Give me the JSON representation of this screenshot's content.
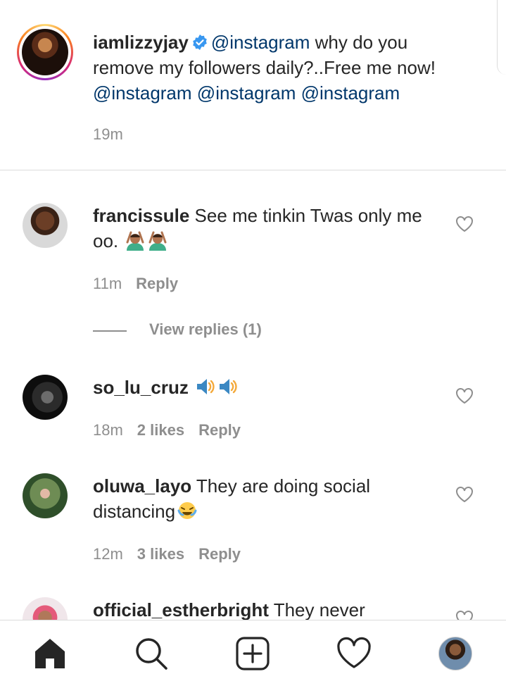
{
  "caption": {
    "username": "iamlizzyjay",
    "text_parts": [
      "@instagram",
      " why do you remove my followers daily?..Free me now! ",
      "@instagram",
      " ",
      "@instagram",
      " ",
      "@instagram"
    ],
    "time": "19m"
  },
  "comments": [
    {
      "username": "francissule",
      "text": "See me tinkin Twas only me oo.",
      "emojis": [
        "person-gesturing-ok",
        "person-gesturing-ok"
      ],
      "time": "11m",
      "likes": "",
      "reply_label": "Reply",
      "view_replies": "View replies (1)"
    },
    {
      "username": "so_lu_cruz",
      "text": "",
      "emojis": [
        "speaker-high-volume",
        "speaker-high-volume"
      ],
      "time": "18m",
      "likes": "2 likes",
      "reply_label": "Reply"
    },
    {
      "username": "oluwa_layo",
      "text": "They are doing social distancing",
      "emojis": [
        "face-with-tears-of-joy"
      ],
      "time": "12m",
      "likes": "3 likes",
      "reply_label": "Reply"
    },
    {
      "username": "official_estherbright",
      "text": "They never"
    }
  ],
  "nav": {
    "items": [
      "home-icon",
      "search-icon",
      "new-post-icon",
      "activity-heart-icon",
      "profile-avatar"
    ]
  },
  "colors": {
    "mention": "#00376b",
    "secondary_text": "#8e8e8e",
    "verified": "#3897f0",
    "divider": "#dbdbdb"
  }
}
